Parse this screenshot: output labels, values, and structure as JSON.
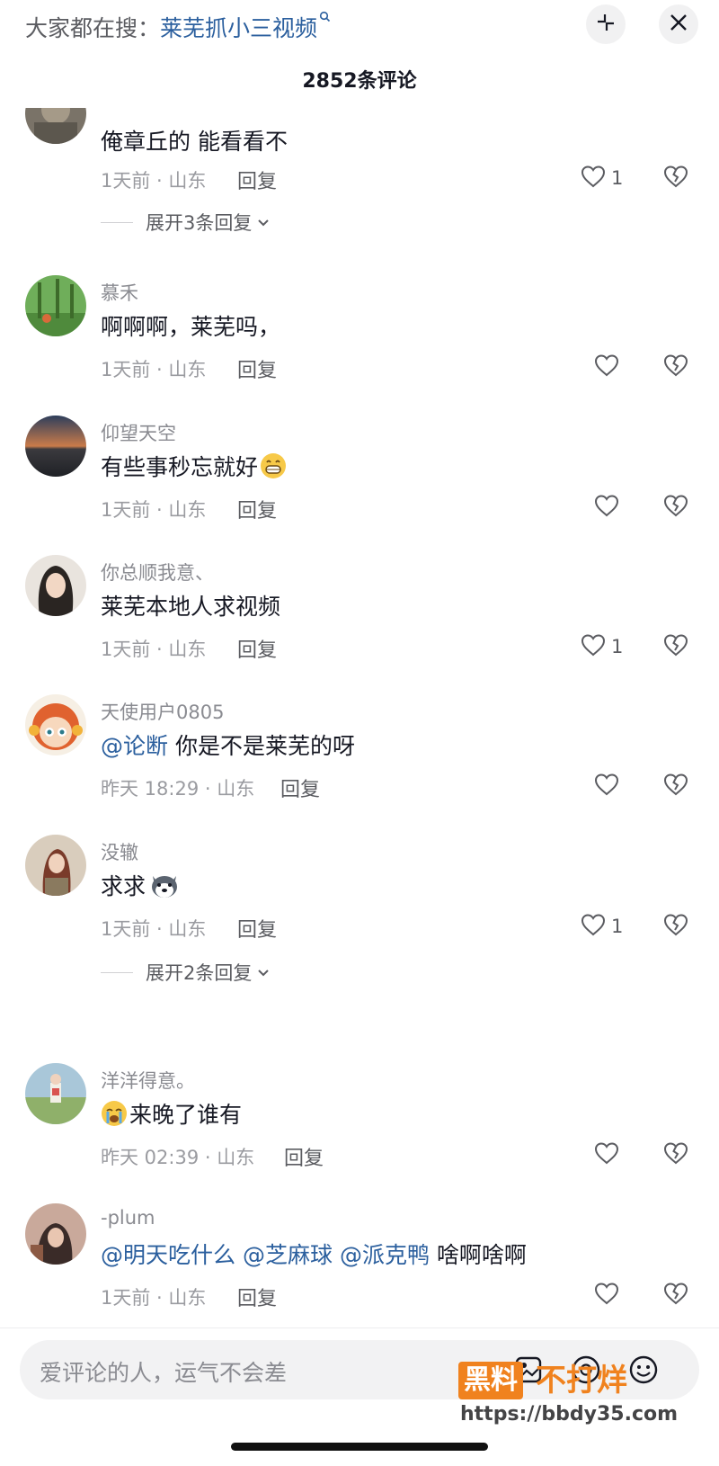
{
  "header": {
    "search_prefix": "大家都在搜：",
    "search_term": "莱芜抓小三视频",
    "comment_count": "2852条评论"
  },
  "comments": [
    {
      "username": "",
      "text": "俺章丘的 能看看不",
      "time": "1天前",
      "location": "山东",
      "reply": "回复",
      "likes": "1",
      "expand": "展开3条回复"
    },
    {
      "username": "慕禾",
      "text": "啊啊啊，莱芜吗，",
      "time": "1天前",
      "location": "山东",
      "reply": "回复",
      "likes": ""
    },
    {
      "username": "仰望天空",
      "text": "有些事秒忘就好",
      "emoji": "grin-emoji",
      "time": "1天前",
      "location": "山东",
      "reply": "回复",
      "likes": ""
    },
    {
      "username": "你总顺我意、",
      "text": "莱芜本地人求视频",
      "time": "1天前",
      "location": "山东",
      "reply": "回复",
      "likes": "1"
    },
    {
      "username": "天使用户0805",
      "mention": "@论断",
      "text": "你是不是莱芜的呀",
      "time": "昨天 18:29",
      "location": "山东",
      "reply": "回复",
      "likes": ""
    },
    {
      "username": "没辙",
      "text": "求求",
      "emoji": "husky-emoji",
      "time": "1天前",
      "location": "山东",
      "reply": "回复",
      "likes": "1",
      "expand": "展开2条回复"
    },
    {
      "username": "洋洋得意。",
      "emoji": "crying-emoji",
      "text": "来晚了谁有",
      "time": "昨天 02:39",
      "location": "山东",
      "reply": "回复",
      "likes": ""
    },
    {
      "username": "-plum",
      "mentions": [
        "@明天吃什么",
        "@芝麻球",
        "@派克鸭"
      ],
      "text": "啥啊啥啊",
      "time": "1天前",
      "location": "山东",
      "reply": "回复",
      "likes": ""
    }
  ],
  "input": {
    "placeholder": "爱评论的人，运气不会差"
  },
  "watermark": {
    "box": "黑料",
    "text": "不打烊",
    "url": "https://bbdy35.com"
  },
  "colors": {
    "accent_link": "#2b5f9e",
    "meta_gray": "#9a9ba0",
    "watermark_orange": "#f0821e"
  }
}
